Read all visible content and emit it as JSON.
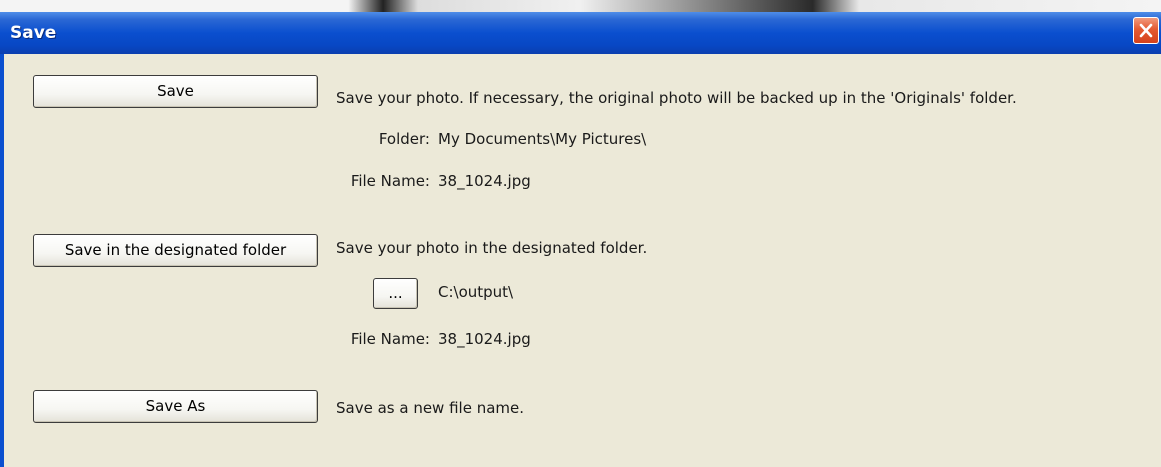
{
  "window": {
    "title": "Save"
  },
  "options": [
    {
      "button_label": "Save",
      "description": "Save your photo. If necessary, the original photo will be backed up in the 'Originals' folder.",
      "folder_label": "Folder:",
      "folder_value": "My Documents\\My Pictures\\",
      "filename_label": "File Name:",
      "filename_value": "38_1024.jpg"
    },
    {
      "button_label": "Save in the designated folder",
      "description": "Save your photo in the designated folder.",
      "browse_label": "...",
      "folder_value": "C:\\output\\",
      "filename_label": "File Name:",
      "filename_value": "38_1024.jpg"
    },
    {
      "button_label": "Save As",
      "description": "Save as a new file name."
    }
  ],
  "icons": {
    "close": "close-icon"
  },
  "colors": {
    "titlebar": "#0a4fcf",
    "dialog_background": "#ece9d8",
    "close_button": "#e45a32"
  }
}
